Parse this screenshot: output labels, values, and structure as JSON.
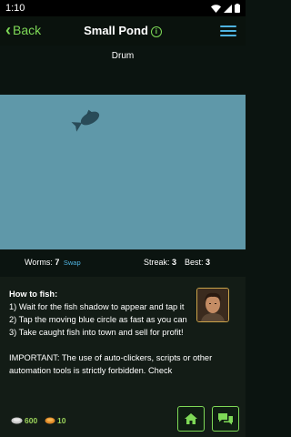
{
  "status_bar": {
    "time": "1:10"
  },
  "header": {
    "back_label": "Back",
    "title": "Small Pond"
  },
  "pond": {
    "fish_name": "Drum"
  },
  "stats": {
    "worms_label": "Worms:",
    "worms_value": "7",
    "swap_label": "Swap",
    "streak_label": "Streak:",
    "streak_value": "3",
    "best_label": "Best:",
    "best_value": "3"
  },
  "help": {
    "heading": "How to fish:",
    "step1": "1) Wait for the fish shadow to appear and tap it",
    "step2": "2) Tap the moving blue circle as fast as you can",
    "step3": "3) Take caught fish into town and sell for profit!",
    "notice": "IMPORTANT: The use of auto-clickers, scripts or other automation tools is strictly forbidden. Check"
  },
  "footer": {
    "silver": "600",
    "gold": "10"
  },
  "colors": {
    "accent": "#7ed957",
    "pond": "#5f98a9",
    "link": "#4fb3e0"
  }
}
